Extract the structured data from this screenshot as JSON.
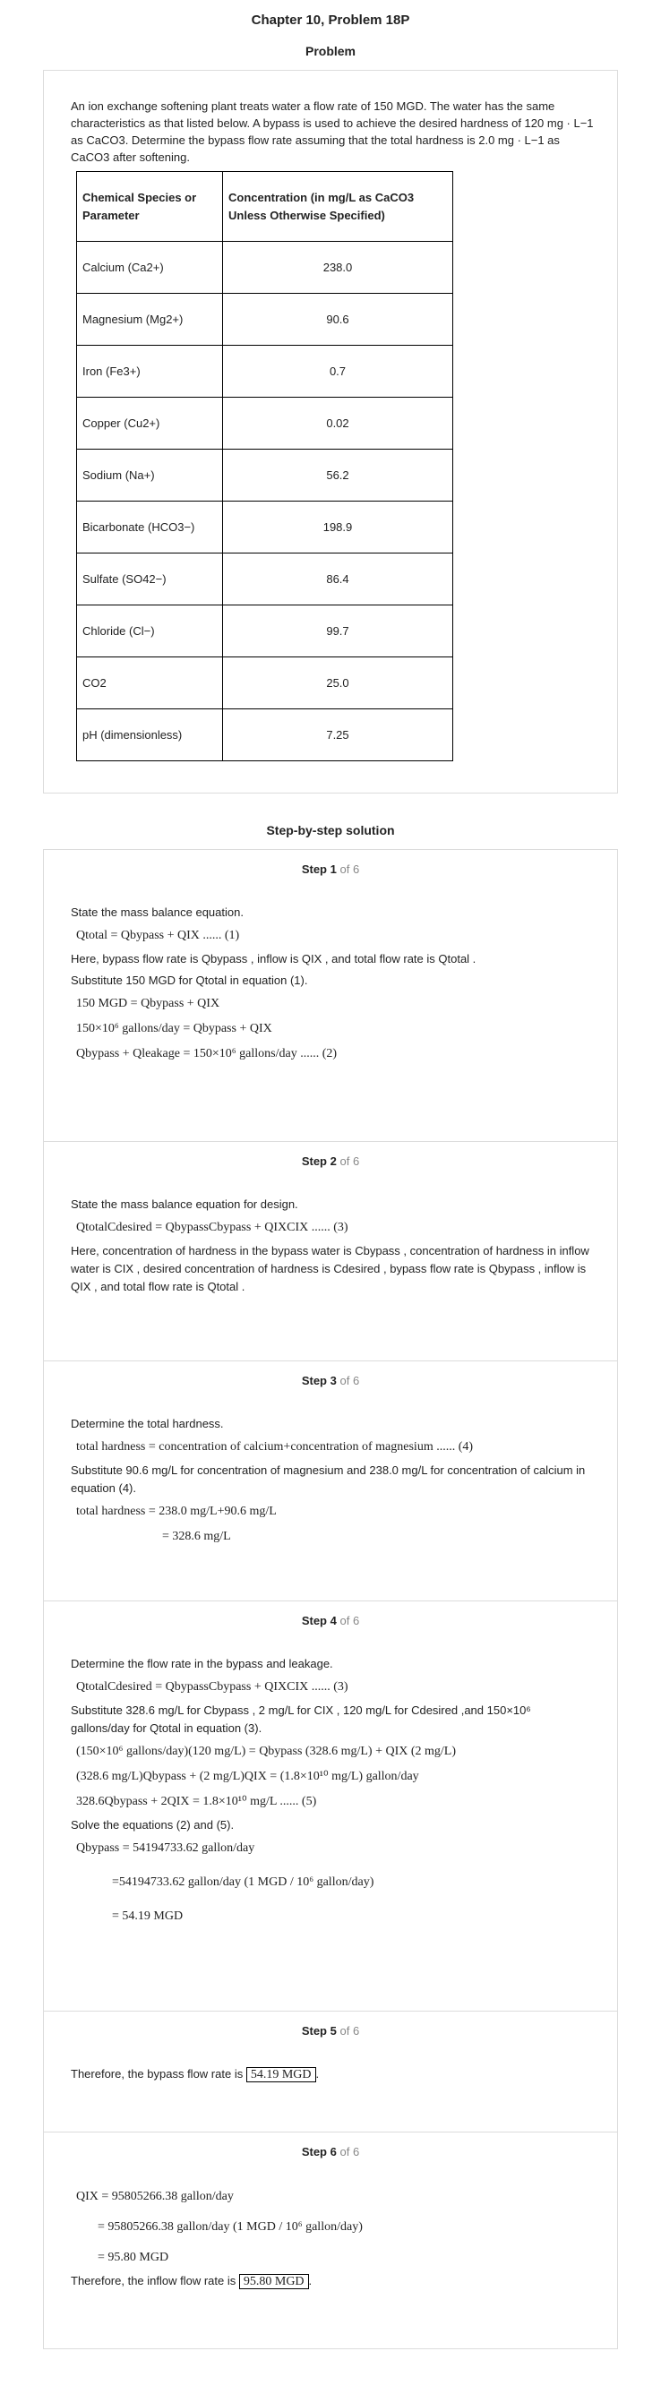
{
  "title": "Chapter 10, Problem 18P",
  "problem_heading": "Problem",
  "problem_text": "An ion exchange softening plant treats water a flow rate of 150 MGD. The water has the same characteristics as that listed below. A bypass is used to achieve the desired hardness of 120 mg · L−1 as CaCO3. Determine the bypass flow rate assuming that the total hardness is 2.0 mg · L−1 as CaCO3 after softening.",
  "table": {
    "headers": [
      "Chemical Species or Parameter",
      "Concentration (in mg/L as CaCO3 Unless Otherwise Specified)"
    ],
    "rows": [
      [
        "Calcium (Ca2+)",
        "238.0"
      ],
      [
        "Magnesium (Mg2+)",
        "90.6"
      ],
      [
        "Iron (Fe3+)",
        "0.7"
      ],
      [
        "Copper (Cu2+)",
        "0.02"
      ],
      [
        "Sodium (Na+)",
        "56.2"
      ],
      [
        "Bicarbonate  (HCO3−)",
        "198.9"
      ],
      [
        "Sulfate  (SO42−)",
        "86.4"
      ],
      [
        "Chloride (Cl−)",
        "99.7"
      ],
      [
        "CO2",
        "25.0"
      ],
      [
        "pH (dimensionless)",
        "7.25"
      ]
    ]
  },
  "solution_heading": "Step-by-step solution",
  "step_word": "Step",
  "of_text": "of 6",
  "steps": [
    {
      "number": "1",
      "lines": [
        "State the mass balance equation.",
        "Qtotal = Qbypass + QIX ...... (1)",
        "Here, bypass flow rate is Qbypass , inflow is QIX , and total flow rate is Qtotal .",
        "Substitute 150 MGD for Qtotal in equation (1).",
        "150 MGD = Qbypass + QIX",
        "150×10⁶ gallons/day = Qbypass + QIX",
        "Qbypass + Qleakage = 150×10⁶ gallons/day ...... (2)"
      ]
    },
    {
      "number": "2",
      "lines": [
        "State the mass balance equation for design.",
        "QtotalCdesired = QbypassCbypass + QIXCIX ...... (3)",
        "Here, concentration of hardness in the bypass water is Cbypass , concentration of hardness in inflow water is CIX , desired concentration of hardness is Cdesired , bypass flow rate is Qbypass , inflow is QIX , and total flow rate is Qtotal ."
      ]
    },
    {
      "number": "3",
      "lines": [
        "Determine the total hardness.",
        "total hardness = concentration of calcium+concentration of magnesium ...... (4)",
        "Substitute 90.6 mg/L for concentration of magnesium and 238.0 mg/L for concentration of calcium in equation (4).",
        "total hardness = 238.0 mg/L+90.6 mg/L",
        "= 328.6 mg/L"
      ]
    },
    {
      "number": "4",
      "lines": [
        "Determine the flow rate in the bypass and leakage.",
        "QtotalCdesired = QbypassCbypass + QIXCIX ...... (3)",
        "Substitute 328.6 mg/L for Cbypass , 2 mg/L for CIX , 120 mg/L for Cdesired ,and 150×10⁶ gallons/day for Qtotal in equation (3).",
        "(150×10⁶ gallons/day)(120 mg/L) = Qbypass (328.6 mg/L) + QIX (2 mg/L)",
        "(328.6 mg/L)Qbypass + (2 mg/L)QIX = (1.8×10¹⁰ mg/L) gallon/day",
        "328.6Qbypass + 2QIX = 1.8×10¹⁰ mg/L ...... (5)",
        "Solve the equations (2) and (5).",
        "Qbypass = 54194733.62 gallon/day",
        "=54194733.62 gallon/day (1 MGD / 10⁶ gallon/day)",
        "= 54.19 MGD"
      ]
    },
    {
      "number": "5",
      "lines": [
        "Therefore, the bypass flow rate is",
        "54.19 MGD"
      ]
    },
    {
      "number": "6",
      "lines": [
        "QIX = 95805266.38 gallon/day",
        "= 95805266.38 gallon/day (1 MGD / 10⁶ gallon/day)",
        "= 95.80 MGD",
        "Therefore, the inflow flow rate is",
        "95.80 MGD"
      ]
    }
  ]
}
